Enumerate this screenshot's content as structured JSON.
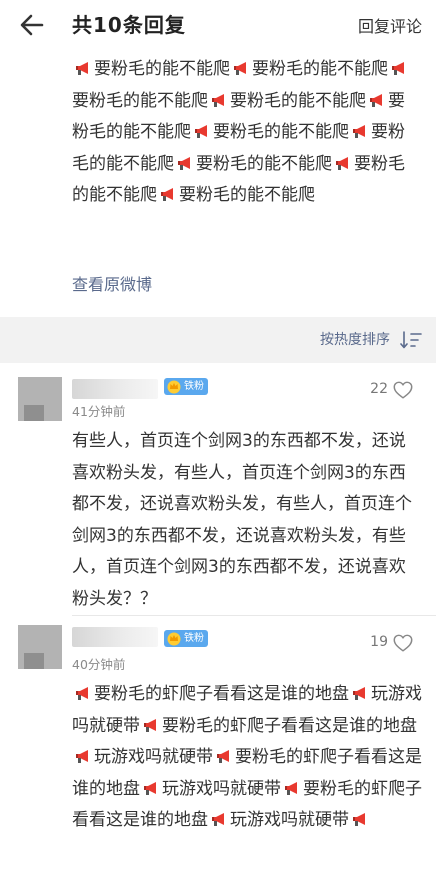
{
  "header": {
    "back_icon": "arrow-left-icon",
    "title": "共10条回复",
    "reply_label": "回复评论"
  },
  "weibo": {
    "segments": [
      "要粉毛的能不能爬",
      "要粉毛的能不能爬",
      "要粉毛的能不能爬",
      "要粉毛的能不能爬",
      "要粉毛的能不能爬",
      "要粉毛的能不能爬",
      "要粉毛的能不能爬",
      "要粉毛的能不能爬",
      "要粉毛的能不能爬",
      "要粉毛的能不能爬"
    ],
    "view_original": "查看原微博"
  },
  "sort": {
    "label": "按热度排序",
    "icon": "sort-desc-icon"
  },
  "comments": [
    {
      "badge": "铁粉",
      "time": "41分钟前",
      "likes": "22",
      "text": "有些人，首页连个剑网3的东西都不发，还说喜欢粉头发，有些人，首页连个剑网3的东西都不发，还说喜欢粉头发，有些人，首页连个剑网3的东西都不发，还说喜欢粉头发，有些人，首页连个剑网3的东西都不发，还说喜欢粉头发？？"
    },
    {
      "badge": "铁粉",
      "time": "40分钟前",
      "likes": "19",
      "segments": [
        "要粉毛的虾爬子看看这是谁的地盘",
        "玩游戏吗就硬带",
        "要粉毛的虾爬子看看这是谁的地盘",
        "玩游戏吗就硬带",
        "要粉毛的虾爬子看看这是谁的地盘",
        "玩游戏吗就硬带",
        "要粉毛的虾爬子看看这是谁的地盘",
        "玩游戏吗就硬带"
      ]
    }
  ],
  "colors": {
    "link": "#5a6a8c",
    "badge": "#5aa8ee",
    "megaphone": "#e8392f",
    "gap": "#f2f2f2"
  }
}
